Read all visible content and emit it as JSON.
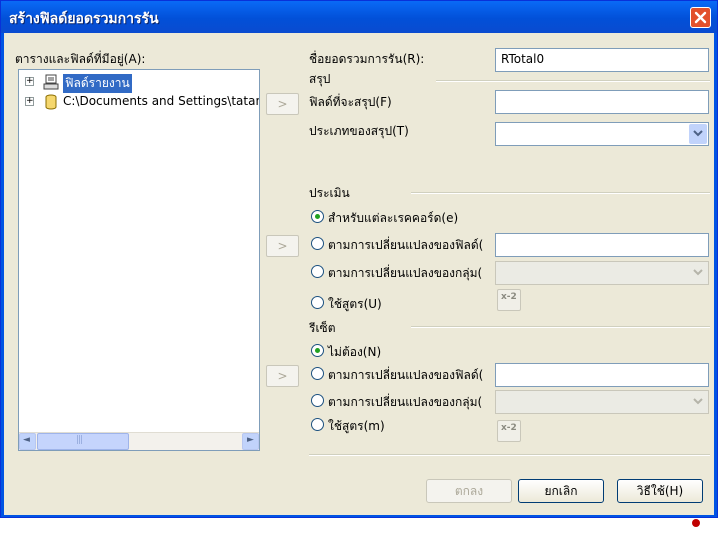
{
  "window": {
    "title": "สร้างฟิลด์ยอดรวมการรัน"
  },
  "left_panel": {
    "label": "ตารางและฟิลด์ที่มีอยู่(A):",
    "tree": [
      {
        "expander": "+",
        "icon": "report-fields-icon",
        "label": "ฟิลด์รายงาน",
        "selected": true
      },
      {
        "expander": "+",
        "icon": "database-icon",
        "label": "C:\\Documents and Settings\\tatan",
        "selected": false
      }
    ],
    "scroll_left": "◄",
    "scroll_right": "►",
    "scroll_grip": "|||"
  },
  "arrow_button": ">",
  "name_field": {
    "label": "ชื่อยอดรวมการรัน(R):",
    "value": "RTotal0"
  },
  "summary": {
    "section_label": "สรุป",
    "field_label": "ฟิลด์ที่จะสรุป(F)",
    "type_label": "ประเภทของสรุป(T)"
  },
  "evaluate": {
    "section_label": "ประเมิน",
    "options": [
      {
        "label": "สำหรับแต่ละเรคคอร์ด(e)",
        "checked": true
      },
      {
        "label": "ตามการเปลี่ยนแปลงของฟิลด์(",
        "checked": false
      },
      {
        "label": "ตามการเปลี่ยนแปลงของกลุ่ม(",
        "checked": false
      },
      {
        "label": "ใช้สูตร(U)",
        "checked": false
      }
    ]
  },
  "reset": {
    "section_label": "รีเซ็ต",
    "options": [
      {
        "label": "ไม่ต้อง(N)",
        "checked": true
      },
      {
        "label": "ตามการเปลี่ยนแปลงของฟิลด์(",
        "checked": false
      },
      {
        "label": "ตามการเปลี่ยนแปลงของกลุ่ม(",
        "checked": false
      },
      {
        "label": "ใช้สูตร(m)",
        "checked": false
      }
    ]
  },
  "formula_icon_text": "x-2",
  "buttons": {
    "ok": "ตกลง",
    "cancel": "ยกเลิก",
    "help": "วิธีใช้(H)"
  },
  "colors": {
    "title_bar": "#0054e3",
    "dialog_bg": "#ece9d8",
    "selection": "#316ac5",
    "accent_dot": "#c00000"
  }
}
